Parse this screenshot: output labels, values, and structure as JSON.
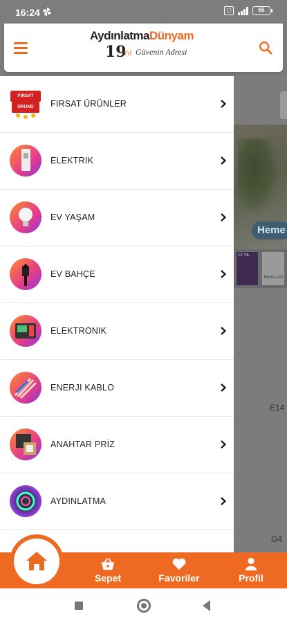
{
  "status_bar": {
    "time": "16:24",
    "left_icon": "fan-icon",
    "right_icons": [
      "sim-icon",
      "signal-icon",
      "battery-icon"
    ],
    "battery_text": "65"
  },
  "header": {
    "menu_icon": "hamburger-icon",
    "logo": {
      "part1": "Aydınlatma",
      "part2": "Dünyam",
      "years": "19",
      "years_suffix": "Yıl",
      "tagline": "Güvenin Adresi"
    },
    "search_icon": "search-icon"
  },
  "drawer": {
    "items": [
      {
        "label": "FIRSAT ÜRÜNLER",
        "thumb_text": "FIRSAT ÜRÜNÜ"
      },
      {
        "label": "ELEKTRIK"
      },
      {
        "label": "EV YAŞAM"
      },
      {
        "label": "EV BAHÇE"
      },
      {
        "label": "ELEKTRONIK"
      },
      {
        "label": "ENERJI KABLO"
      },
      {
        "label": "ANAHTAR PRİZ"
      },
      {
        "label": "AYDINLATMA"
      }
    ]
  },
  "background": {
    "pill_text": "Heme",
    "thumb_text_1": "12 YIL",
    "thumb_text_2": "MODELLER",
    "label_1": "E14",
    "label_2": "G4"
  },
  "bottom_nav": {
    "home_icon": "home-icon",
    "items": [
      {
        "label": "Sepet",
        "icon": "basket-icon"
      },
      {
        "label": "Favoriler",
        "icon": "heart-icon"
      },
      {
        "label": "Profil",
        "icon": "user-icon"
      }
    ]
  },
  "colors": {
    "accent": "#ee6a22",
    "scrim": "#7c7c7c",
    "text": "#222222"
  }
}
